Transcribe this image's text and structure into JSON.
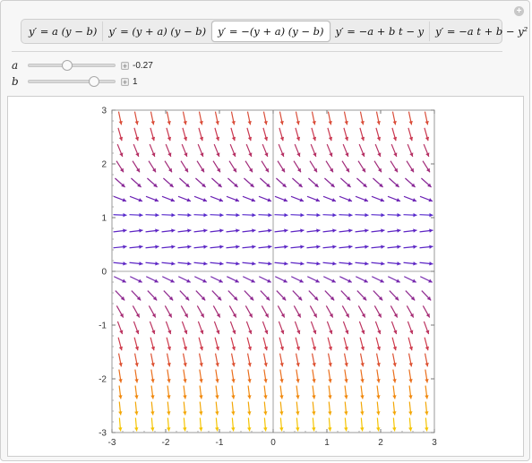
{
  "tabs": [
    {
      "label": "y′ = a (y − b)",
      "selected": false
    },
    {
      "label": "y′ = (y + a) (y − b)",
      "selected": false
    },
    {
      "label": "y′ = −(y + a) (y − b)",
      "selected": true
    },
    {
      "label": "y′ = −a + b t − y",
      "selected": false
    },
    {
      "label": "y′ = −a t + b − y²",
      "selected": false
    }
  ],
  "controls": {
    "a": {
      "label": "a",
      "value_text": "-0.27",
      "value": -0.27,
      "min": -2,
      "max": 2
    },
    "b": {
      "label": "b",
      "value_text": "1",
      "value": 1,
      "min": -2,
      "max": 2
    }
  },
  "chart_data": {
    "type": "vector_field",
    "equation": "y' = -(y + a)(y - b)",
    "a": -0.27,
    "b": 1,
    "xlim": [
      -3,
      3
    ],
    "ylim": [
      -3,
      3
    ],
    "x_ticks": [
      "-3",
      "-2",
      "-1",
      "0",
      "1",
      "2",
      "3"
    ],
    "y_ticks": [
      "-3",
      "-2",
      "-1",
      "0",
      "1",
      "2",
      "3"
    ],
    "grid_points": 20,
    "color_scale": [
      "#f5c400",
      "#f07a10",
      "#d03a4a",
      "#a02a7a",
      "#6a24b8",
      "#4a2ad8"
    ]
  }
}
